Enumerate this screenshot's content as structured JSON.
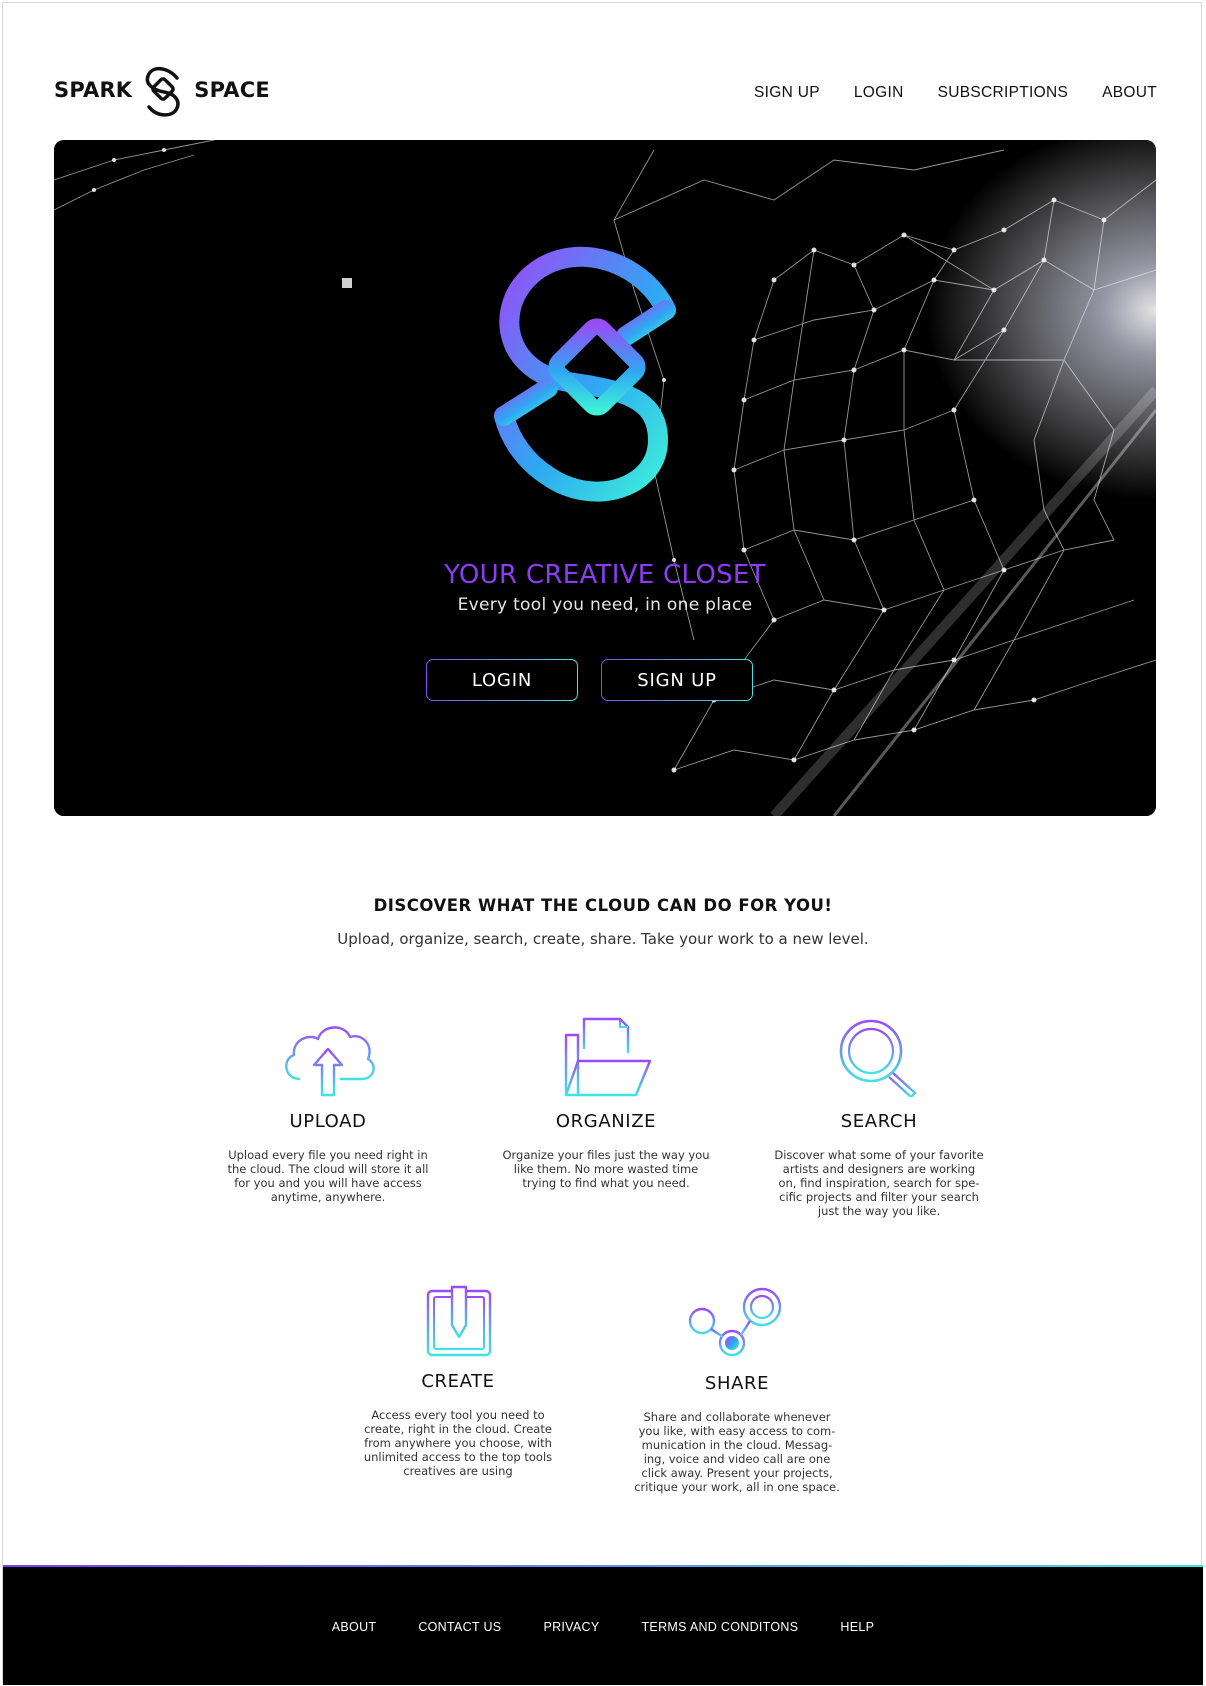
{
  "brand": {
    "left_word": "SPARK",
    "right_word": "SPACE",
    "logo_icon": "spark-space-s-logo"
  },
  "nav": {
    "items": [
      {
        "label": "SIGN UP"
      },
      {
        "label": "LOGIN"
      },
      {
        "label": "SUBSCRIPTIONS"
      },
      {
        "label": "ABOUT"
      }
    ]
  },
  "hero": {
    "title": "YOUR CREATIVE CLOSET",
    "subtitle": "Every tool you need, in one place",
    "login_label": "LOGIN",
    "signup_label": "SIGN UP",
    "background": "network-mesh-image"
  },
  "features": {
    "title": "DISCOVER WHAT THE CLOUD CAN DO FOR YOU!",
    "subtitle": "Upload, organize, search, create, share. Take your work to a new level.",
    "items": [
      {
        "icon": "cloud-upload-icon",
        "title": "UPLOAD",
        "description": "Upload every file you need right in the cloud. The cloud will store it all for you and you will have access anytime, anywhere."
      },
      {
        "icon": "folder-document-icon",
        "title": "ORGANIZE",
        "description": "Organize your files just the way you like them. No more wasted time trying to find what you need."
      },
      {
        "icon": "magnifier-icon",
        "title": "SEARCH",
        "description": "Discover what some of your favorite artists and designers are working on, find inspiration, search for spe-cific projects and filter your search just the way you like."
      },
      {
        "icon": "pencil-tablet-icon",
        "title": "CREATE",
        "description": "Access every tool you need to create, right in the cloud. Create from anywhere you choose, with unlimited access to the top tools creatives are using"
      },
      {
        "icon": "share-nodes-icon",
        "title": "SHARE",
        "description": "Share and collaborate whenever you like, with easy access to com-munication in the cloud. Messag-ing, voice and video call are one click away. Present your projects, critique your work, all in one space."
      }
    ]
  },
  "footer": {
    "links": [
      {
        "label": "ABOUT"
      },
      {
        "label": "CONTACT US"
      },
      {
        "label": "PRIVACY"
      },
      {
        "label": "TERMS AND CONDITONS"
      },
      {
        "label": "HELP"
      }
    ]
  },
  "colors": {
    "accent_purple": "#8b3df4",
    "accent_cyan": "#3ee4e4",
    "hero_bg": "#000000",
    "footer_bg": "#000000"
  }
}
